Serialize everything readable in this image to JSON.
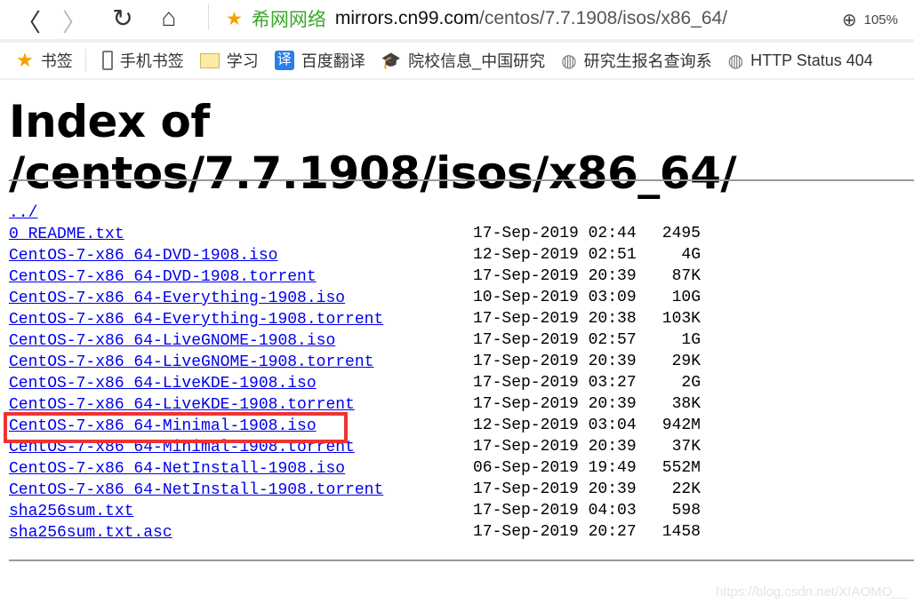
{
  "browser": {
    "back": "〈",
    "forward": "〉",
    "reload": "↻",
    "home": "⌂",
    "site_name": "希网网络",
    "url_host": "mirrors.cn99.com",
    "url_path": "/centos/7.7.1908/isos/x86_64/",
    "zoom": "105%"
  },
  "bookmarks": [
    {
      "label": "书签",
      "icon": "star-icon"
    },
    {
      "label": "手机书签",
      "icon": "phone-icon"
    },
    {
      "label": "学习",
      "icon": "folder-icon"
    },
    {
      "label": "百度翻译",
      "icon": "translate-icon"
    },
    {
      "label": "院校信息_中国研究",
      "icon": "graduation-cap-icon"
    },
    {
      "label": "研究生报名查询系",
      "icon": "globe-icon"
    },
    {
      "label": "HTTP Status 404",
      "icon": "globe-icon"
    }
  ],
  "page": {
    "title": "Index of /centos/7.7.1908/isos/x86_64/",
    "parent": "../",
    "files": [
      {
        "name": "0_README.txt",
        "date": "17-Sep-2019 02:44",
        "size": "2495"
      },
      {
        "name": "CentOS-7-x86_64-DVD-1908.iso",
        "date": "12-Sep-2019 02:51",
        "size": "4G"
      },
      {
        "name": "CentOS-7-x86_64-DVD-1908.torrent",
        "date": "17-Sep-2019 20:39",
        "size": "87K"
      },
      {
        "name": "CentOS-7-x86_64-Everything-1908.iso",
        "date": "10-Sep-2019 03:09",
        "size": "10G"
      },
      {
        "name": "CentOS-7-x86_64-Everything-1908.torrent",
        "date": "17-Sep-2019 20:38",
        "size": "103K"
      },
      {
        "name": "CentOS-7-x86_64-LiveGNOME-1908.iso",
        "date": "17-Sep-2019 02:57",
        "size": "1G"
      },
      {
        "name": "CentOS-7-x86_64-LiveGNOME-1908.torrent",
        "date": "17-Sep-2019 20:39",
        "size": "29K"
      },
      {
        "name": "CentOS-7-x86_64-LiveKDE-1908.iso",
        "date": "17-Sep-2019 03:27",
        "size": "2G"
      },
      {
        "name": "CentOS-7-x86_64-LiveKDE-1908.torrent",
        "date": "17-Sep-2019 20:39",
        "size": "38K"
      },
      {
        "name": "CentOS-7-x86_64-Minimal-1908.iso",
        "date": "12-Sep-2019 03:04",
        "size": "942M",
        "highlighted": true
      },
      {
        "name": "CentOS-7-x86_64-Minimal-1908.torrent",
        "date": "17-Sep-2019 20:39",
        "size": "37K"
      },
      {
        "name": "CentOS-7-x86_64-NetInstall-1908.iso",
        "date": "06-Sep-2019 19:49",
        "size": "552M"
      },
      {
        "name": "CentOS-7-x86_64-NetInstall-1908.torrent",
        "date": "17-Sep-2019 20:39",
        "size": "22K"
      },
      {
        "name": "sha256sum.txt",
        "date": "17-Sep-2019 04:03",
        "size": "598"
      },
      {
        "name": "sha256sum.txt.asc",
        "date": "17-Sep-2019 20:27",
        "size": "1458"
      }
    ]
  },
  "colors": {
    "link": "#0000ee",
    "highlight": "#ee3333",
    "site": "#3aa829"
  },
  "watermark": "https://blog.csdn.net/XIAOMO__"
}
